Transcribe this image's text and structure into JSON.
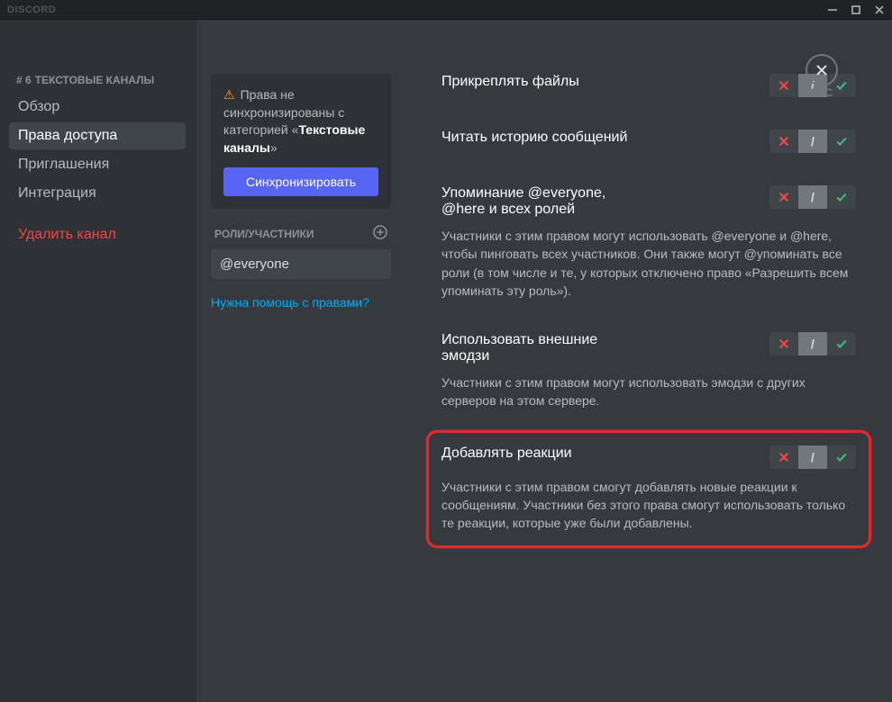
{
  "titlebar": {
    "logo": "DISCORD"
  },
  "close": {
    "label": "ESC"
  },
  "sidebar": {
    "header_prefix": "# 6",
    "header": "ТЕКСТОВЫЕ КАНАЛЫ",
    "items": [
      {
        "label": "Обзор"
      },
      {
        "label": "Права доступа"
      },
      {
        "label": "Приглашения"
      },
      {
        "label": "Интеграция"
      }
    ],
    "delete": "Удалить канал"
  },
  "sync": {
    "text_prefix": "Права не синхронизированы с категорией «",
    "category": "Текстовые каналы",
    "text_suffix": "»",
    "button": "Синхронизировать"
  },
  "roles": {
    "header": "РОЛИ/УЧАСТНИКИ",
    "items": [
      {
        "label": "@everyone"
      }
    ]
  },
  "help_link": "Нужна помощь с правами?",
  "permissions": [
    {
      "id": "attach-files",
      "title": "Прикреплять файлы",
      "desc": "",
      "value": "neutral"
    },
    {
      "id": "read-history",
      "title": "Читать историю сообщений",
      "desc": "",
      "value": "neutral"
    },
    {
      "id": "mention-everyone",
      "title": "Упоминание @everyone, @here и всех ролей",
      "desc": "Участники с этим правом могут использовать @everyone и @here, чтобы пинговать всех участников. Они также могут @упоминать все роли (в том числе и те, у которых отключено право «Разрешить всем упоминать эту роль»).",
      "value": "neutral"
    },
    {
      "id": "external-emoji",
      "title": "Использовать внешние эмодзи",
      "desc": "Участники с этим правом могут использовать эмодзи с других серверов на этом сервере.",
      "value": "neutral"
    },
    {
      "id": "add-reactions",
      "title": "Добавлять реакции",
      "desc": "Участники с этим правом смогут добавлять новые реакции к сообщениям. Участники без этого права смогут использовать только те реакции, которые уже были добавлены.",
      "value": "neutral",
      "highlighted": true
    }
  ]
}
